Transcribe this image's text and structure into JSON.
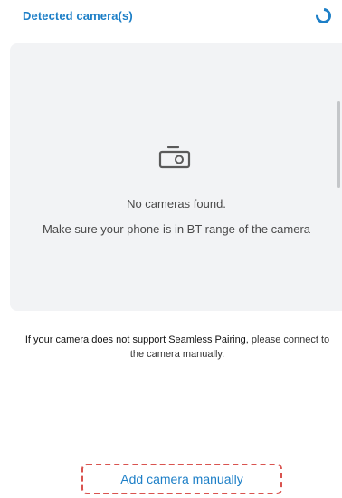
{
  "header": {
    "title": "Detected camera(s)",
    "spinner_icon": "loading-spinner-icon"
  },
  "empty_state": {
    "icon": "camera-icon",
    "title": "No cameras found.",
    "hint": "Make sure your phone is in BT range of the camera"
  },
  "pairing_note": {
    "lead": "If your camera does not support Seamless Pairing,",
    "rest": " please connect to the camera manually."
  },
  "actions": {
    "add_manual_label": "Add camera manually"
  },
  "colors": {
    "accent": "#1d7fc7",
    "panel_bg": "#f2f3f5",
    "highlight_border": "#d9534f"
  }
}
